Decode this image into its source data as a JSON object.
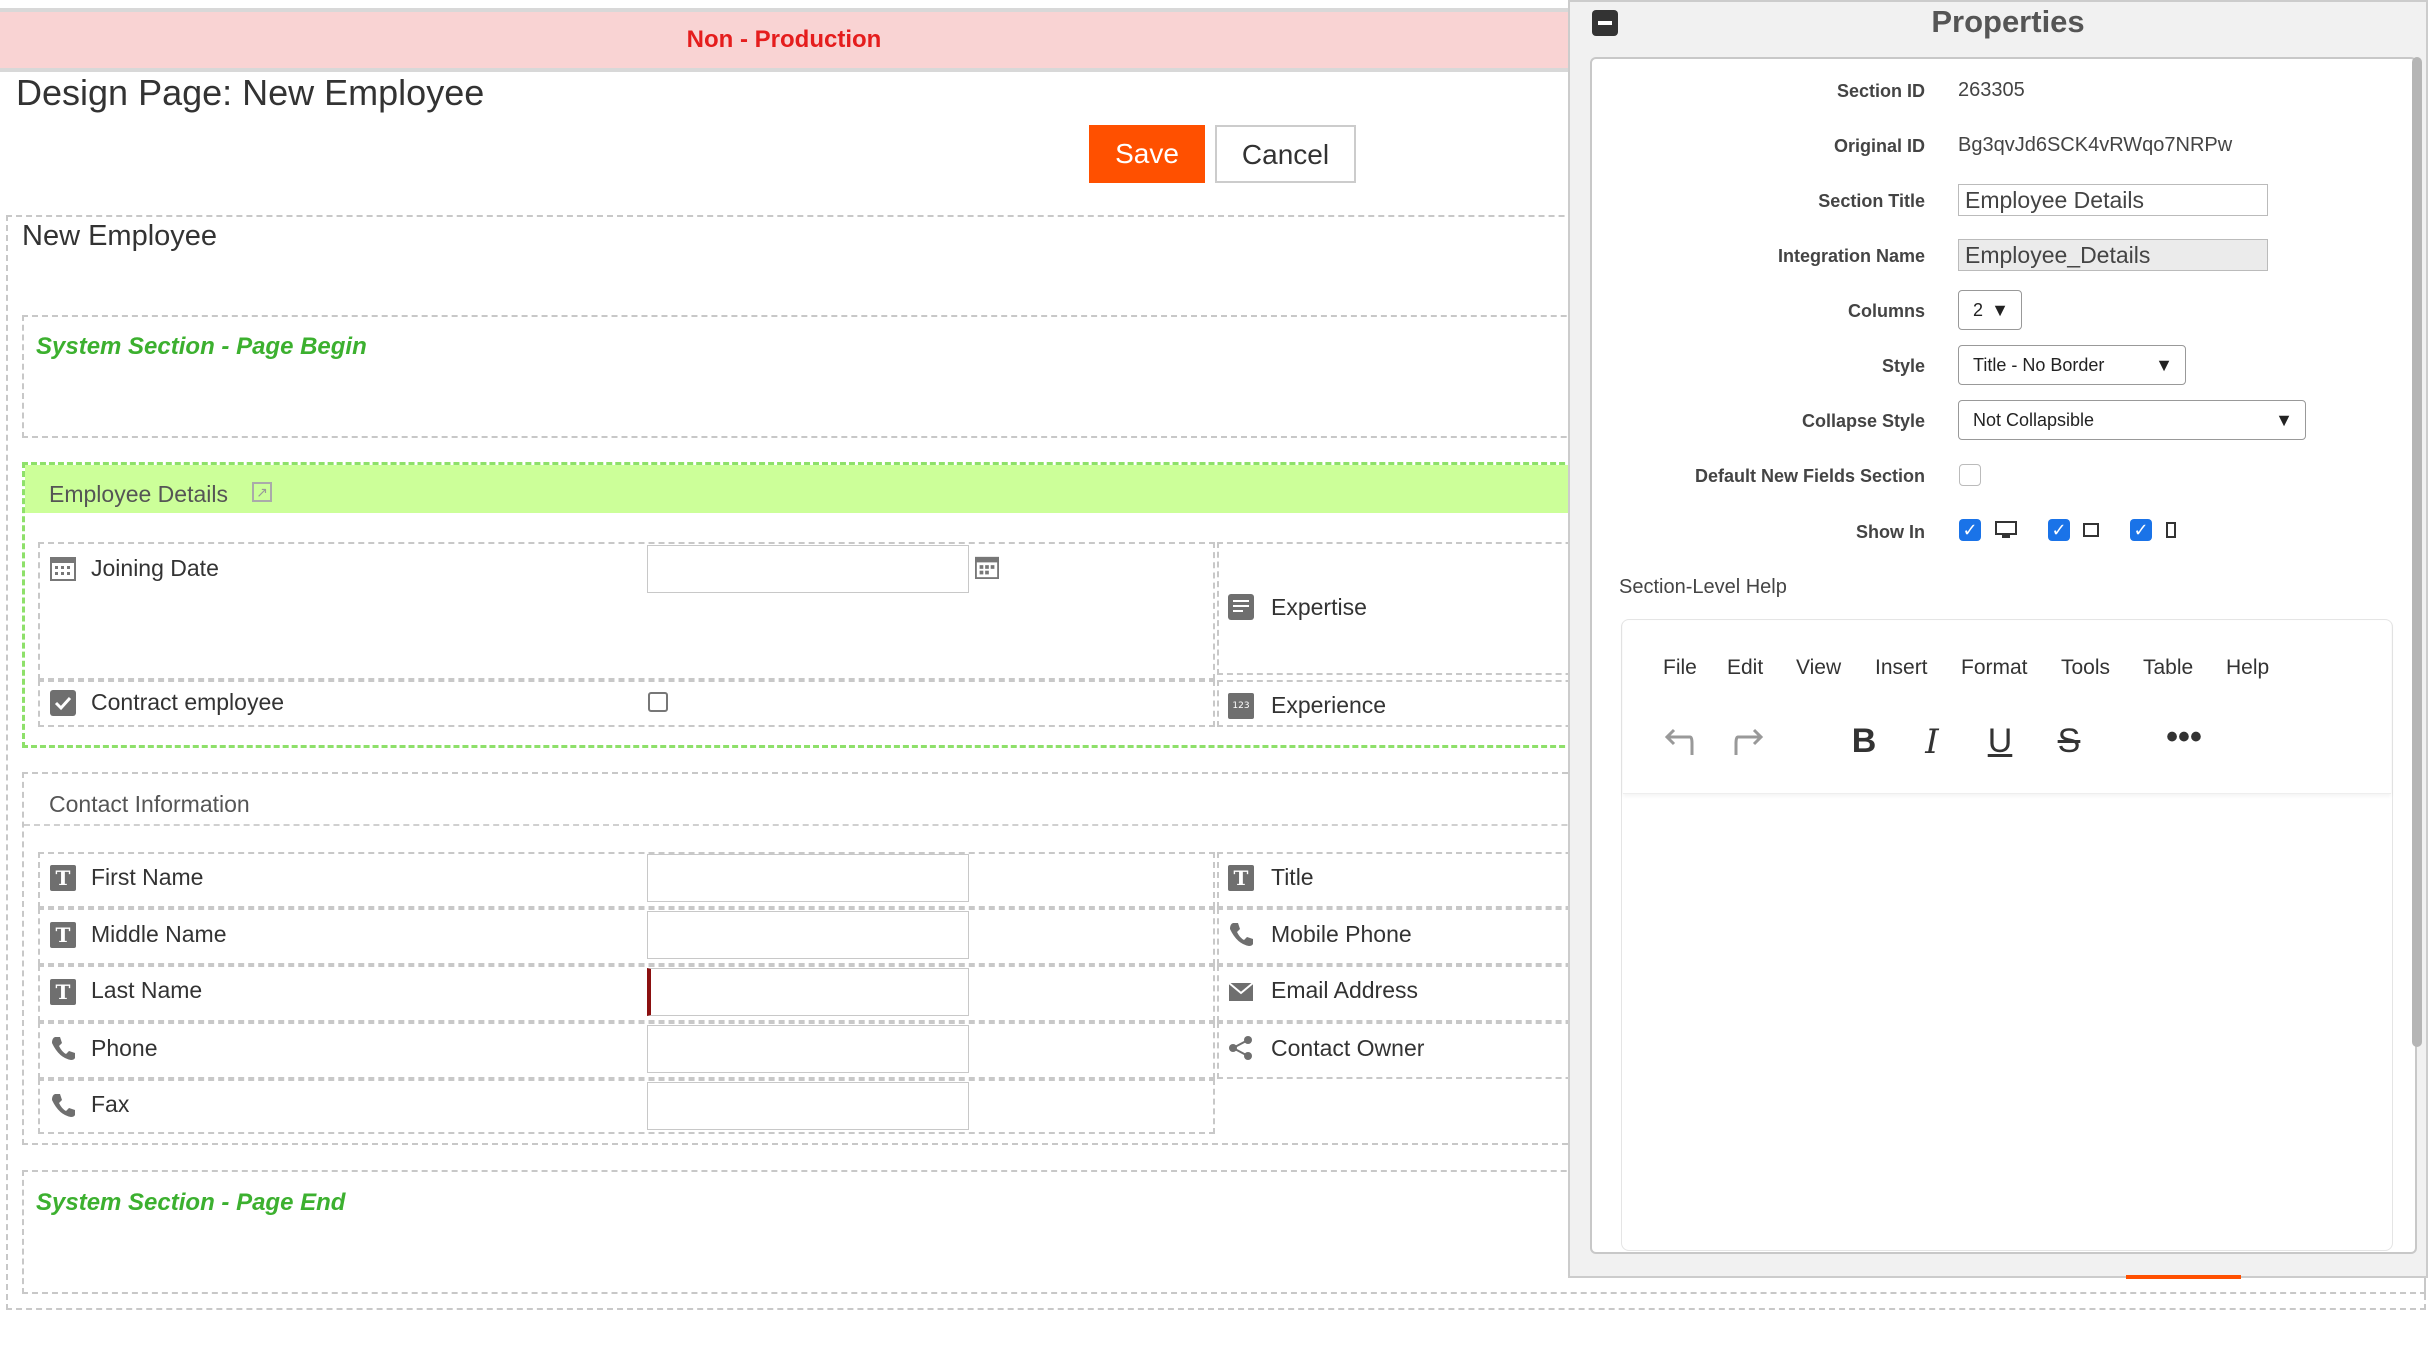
{
  "banner": {
    "text": "Non - Production"
  },
  "page": {
    "title": "Design Page: New Employee"
  },
  "toolbar": {
    "save_label": "Save",
    "cancel_label": "Cancel"
  },
  "form": {
    "title": "New Employee",
    "system_begin": "System Section - Page Begin",
    "system_end": "System Section - Page End",
    "employee_section": {
      "title": "Employee Details",
      "left_fields": [
        {
          "label": "Joining Date",
          "icon": "calendar-icon"
        },
        {
          "label": "Contract employee",
          "icon": "checkbox-icon"
        }
      ],
      "right_fields": [
        {
          "label": "Expertise",
          "icon": "text-area-icon"
        },
        {
          "label": "Experience",
          "icon": "number-icon",
          "icon_text": "123"
        }
      ]
    },
    "contact_section": {
      "title": "Contact Information",
      "left_fields": [
        {
          "label": "First Name",
          "icon": "text-icon",
          "icon_text": "T"
        },
        {
          "label": "Middle Name",
          "icon": "text-icon",
          "icon_text": "T"
        },
        {
          "label": "Last Name",
          "icon": "text-icon",
          "icon_text": "T"
        },
        {
          "label": "Phone",
          "icon": "phone-icon"
        },
        {
          "label": "Fax",
          "icon": "phone-icon"
        }
      ],
      "right_fields": [
        {
          "label": "Title",
          "icon": "text-icon",
          "icon_text": "T"
        },
        {
          "label": "Mobile Phone",
          "icon": "phone-icon"
        },
        {
          "label": "Email Address",
          "icon": "envelope-icon"
        },
        {
          "label": "Contact Owner",
          "icon": "share-icon"
        }
      ]
    }
  },
  "properties": {
    "title": "Properties",
    "section_id_label": "Section ID",
    "section_id": "263305",
    "original_id_label": "Original ID",
    "original_id": "Bg3qvJd6SCK4vRWqo7NRPw",
    "section_title_label": "Section Title",
    "section_title": "Employee Details",
    "integration_name_label": "Integration Name",
    "integration_name": "Employee_Details",
    "columns_label": "Columns",
    "columns": "2",
    "style_label": "Style",
    "style": "Title - No Border",
    "collapse_label": "Collapse Style",
    "collapse": "Not Collapsible",
    "default_new_fields_label": "Default New Fields Section",
    "show_in_label": "Show In",
    "help_label": "Section-Level Help",
    "editor_menu": [
      "File",
      "Edit",
      "View",
      "Insert",
      "Format",
      "Tools",
      "Table",
      "Help"
    ],
    "editor_tools": [
      "undo",
      "redo",
      "bold",
      "italic",
      "underline",
      "strikethrough",
      "more"
    ]
  },
  "colors": {
    "accent": "#ff5000",
    "highlight": "#ccff99",
    "system_green": "#3cb02f",
    "banner_red": "#e51d1d",
    "check_blue": "#1a73e8"
  }
}
